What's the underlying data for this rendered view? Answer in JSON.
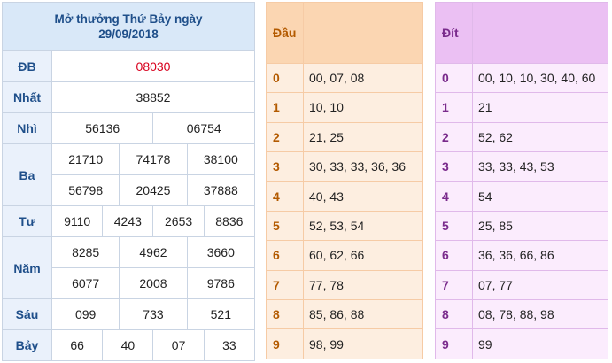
{
  "results": {
    "title_line1": "Mở thưởng Thứ Bảy ngày",
    "title_line2": "29/09/2018",
    "db": {
      "label": "ĐB",
      "values": [
        "08030"
      ]
    },
    "nhat": {
      "label": "Nhất",
      "values": [
        "38852"
      ]
    },
    "nhi": {
      "label": "Nhì",
      "values": [
        "56136",
        "06754"
      ]
    },
    "ba": {
      "label": "Ba",
      "values": [
        "21710",
        "74178",
        "38100",
        "56798",
        "20425",
        "37888"
      ]
    },
    "tu": {
      "label": "Tư",
      "values": [
        "9110",
        "4243",
        "2653",
        "8836"
      ]
    },
    "nam": {
      "label": "Năm",
      "values": [
        "8285",
        "4962",
        "3660",
        "6077",
        "2008",
        "9786"
      ]
    },
    "sau": {
      "label": "Sáu",
      "values": [
        "099",
        "733",
        "521"
      ]
    },
    "bay": {
      "label": "Bảy",
      "values": [
        "66",
        "40",
        "07",
        "33"
      ]
    }
  },
  "dau": {
    "header": "Đầu",
    "rows": [
      {
        "k": "0",
        "v": "00, 07, 08"
      },
      {
        "k": "1",
        "v": "10, 10"
      },
      {
        "k": "2",
        "v": "21, 25"
      },
      {
        "k": "3",
        "v": "30, 33, 33, 36, 36"
      },
      {
        "k": "4",
        "v": "40, 43"
      },
      {
        "k": "5",
        "v": "52, 53, 54"
      },
      {
        "k": "6",
        "v": "60, 62, 66"
      },
      {
        "k": "7",
        "v": "77, 78"
      },
      {
        "k": "8",
        "v": "85, 86, 88"
      },
      {
        "k": "9",
        "v": "98, 99"
      }
    ]
  },
  "dit": {
    "header": "Đít",
    "rows": [
      {
        "k": "0",
        "v": "00, 10, 10, 30, 40, 60"
      },
      {
        "k": "1",
        "v": "21"
      },
      {
        "k": "2",
        "v": "52, 62"
      },
      {
        "k": "3",
        "v": "33, 33, 43, 53"
      },
      {
        "k": "4",
        "v": "54"
      },
      {
        "k": "5",
        "v": "25, 85"
      },
      {
        "k": "6",
        "v": "36, 36, 66, 86"
      },
      {
        "k": "7",
        "v": "07, 77"
      },
      {
        "k": "8",
        "v": "08, 78, 88, 98"
      },
      {
        "k": "9",
        "v": "99"
      }
    ]
  },
  "colors": {
    "results_header_bg": "#d9e8f8",
    "results_label": "#1f4f8a",
    "special_prize": "#d8001d",
    "dau_bg": "#fdeee0",
    "dau_header_bg": "#fbd6b2",
    "dit_bg": "#fbecfd",
    "dit_header_bg": "#ebc0f3"
  }
}
